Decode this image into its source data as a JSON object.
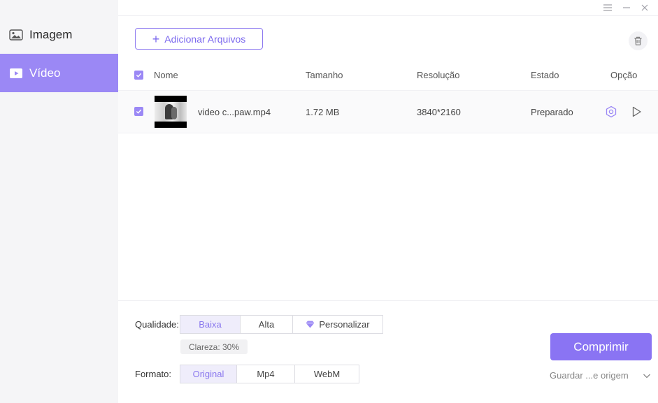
{
  "sidebar": {
    "items": [
      {
        "label": "Imagem",
        "icon": "image-icon",
        "active": false
      },
      {
        "label": "Vídeo",
        "icon": "video-icon",
        "active": true
      }
    ]
  },
  "toolbar": {
    "add_files_label": "Adicionar Arquivos"
  },
  "table": {
    "headers": {
      "name": "Nome",
      "size": "Tamanho",
      "resolution": "Resolução",
      "status": "Estado",
      "option": "Opção"
    },
    "rows": [
      {
        "checked": true,
        "name": "video c...paw.mp4",
        "size": "1.72 MB",
        "resolution": "3840*2160",
        "status": "Preparado"
      }
    ]
  },
  "quality": {
    "label": "Qualidade:",
    "options": [
      "Baixa",
      "Alta",
      "Personalizar"
    ],
    "selected": "Baixa",
    "clarity": "Clareza: 30%"
  },
  "format": {
    "label": "Formato:",
    "options": [
      "Original",
      "Mp4",
      "WebM"
    ],
    "selected": "Original"
  },
  "actions": {
    "compress_label": "Comprimir",
    "save_location": "Guardar ...e origem"
  },
  "colors": {
    "accent": "#8a74f3",
    "sidebar_active": "#9b88f5",
    "selected_segment_bg": "#efedfb"
  }
}
